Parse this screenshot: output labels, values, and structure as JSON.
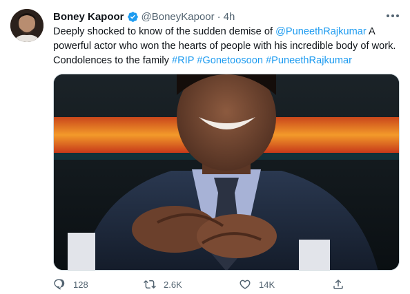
{
  "tweet": {
    "author_name": "Boney Kapoor",
    "handle": "@BoneyKapoor",
    "separator": "·",
    "time": "4h",
    "text_parts": {
      "p1": "Deeply shocked to know of the sudden demise of ",
      "mention": "@PuneethRajkumar",
      "p2": " A powerful actor who won the hearts of people with his incredible body of work. Condolences to the family ",
      "tag1": "#RIP",
      "tag2": "#Gonetoosoon",
      "tag3": "#PuneethRajkumar"
    }
  },
  "actions": {
    "reply_count": "128",
    "retweet_count": "2.6K",
    "like_count": "14K"
  },
  "icons": {
    "verified": "verified-badge-icon",
    "more": "more-options-icon",
    "reply": "reply-icon",
    "retweet": "retweet-icon",
    "like": "like-icon",
    "share": "share-icon"
  },
  "colors": {
    "link": "#1d9bf0",
    "muted": "#536471",
    "text": "#0f1419"
  }
}
